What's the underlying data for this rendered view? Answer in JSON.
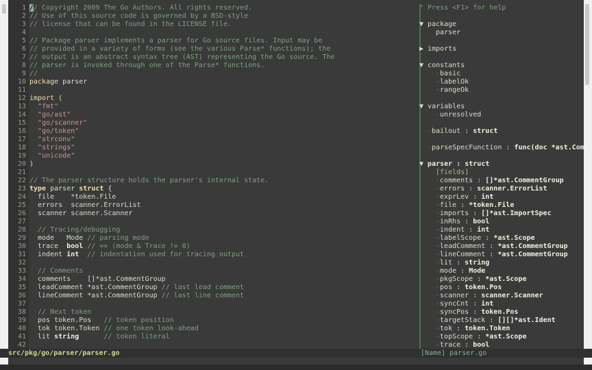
{
  "editor": {
    "cursor_line": 1,
    "lines": [
      [
        [
          "c",
          "// Copyright 2009 The Go Authors. All rights reserved."
        ]
      ],
      [
        [
          "c",
          "// Use of this source code is governed by a BSD-style"
        ]
      ],
      [
        [
          "c",
          "// license that can be found in the LICENSE file."
        ]
      ],
      [],
      [
        [
          "c",
          "// Package parser implements a parser for Go source files. Input may be"
        ]
      ],
      [
        [
          "c",
          "// provided in a variety of forms (see the various Parse* functions); the"
        ]
      ],
      [
        [
          "c",
          "// output is an abstract syntax tree (AST) representing the Go source. The"
        ]
      ],
      [
        [
          "c",
          "// parser is invoked through one of the Parse* functions."
        ]
      ],
      [
        [
          "c",
          "//"
        ]
      ],
      [
        [
          "kw",
          "package"
        ],
        [
          "t",
          " parser"
        ]
      ],
      [],
      [
        [
          "kw",
          "import"
        ],
        [
          "t",
          " ("
        ]
      ],
      [
        [
          "t",
          "  "
        ],
        [
          "s",
          "\"fmt\""
        ]
      ],
      [
        [
          "t",
          "  "
        ],
        [
          "s",
          "\"go/ast\""
        ]
      ],
      [
        [
          "t",
          "  "
        ],
        [
          "s",
          "\"go/scanner\""
        ]
      ],
      [
        [
          "t",
          "  "
        ],
        [
          "s",
          "\"go/token\""
        ]
      ],
      [
        [
          "t",
          "  "
        ],
        [
          "s",
          "\"strconv\""
        ]
      ],
      [
        [
          "t",
          "  "
        ],
        [
          "s",
          "\"strings\""
        ]
      ],
      [
        [
          "t",
          "  "
        ],
        [
          "s",
          "\"unicode\""
        ]
      ],
      [
        [
          "t",
          ")"
        ]
      ],
      [],
      [
        [
          "c",
          "// The parser structure holds the parser's internal state."
        ]
      ],
      [
        [
          "k",
          "type"
        ],
        [
          "t",
          " parser "
        ],
        [
          "k",
          "struct"
        ],
        [
          "t",
          " {"
        ]
      ],
      [
        [
          "t",
          "  file    *token.File"
        ]
      ],
      [
        [
          "t",
          "  errors  scanner.ErrorList"
        ]
      ],
      [
        [
          "t",
          "  scanner scanner.Scanner"
        ]
      ],
      [],
      [
        [
          "t",
          "  "
        ],
        [
          "c",
          "// Tracing/debugging"
        ]
      ],
      [
        [
          "t",
          "  mode   Mode "
        ],
        [
          "c",
          "// parsing mode"
        ]
      ],
      [
        [
          "t",
          "  trace  "
        ],
        [
          "b",
          "bool"
        ],
        [
          "t",
          " "
        ],
        [
          "c",
          "// == (mode & Trace != 0)"
        ]
      ],
      [
        [
          "t",
          "  indent "
        ],
        [
          "b",
          "int"
        ],
        [
          "t",
          "  "
        ],
        [
          "c",
          "// indentation used for tracing output"
        ]
      ],
      [],
      [
        [
          "t",
          "  "
        ],
        [
          "c",
          "// Comments"
        ]
      ],
      [
        [
          "t",
          "  comments    []*ast.CommentGroup"
        ]
      ],
      [
        [
          "t",
          "  leadComment *ast.CommentGroup "
        ],
        [
          "c",
          "// last lead comment"
        ]
      ],
      [
        [
          "t",
          "  lineComment *ast.CommentGroup "
        ],
        [
          "c",
          "// last line comment"
        ]
      ],
      [],
      [
        [
          "t",
          "  "
        ],
        [
          "c",
          "// Next token"
        ]
      ],
      [
        [
          "t",
          "  pos token.Pos   "
        ],
        [
          "c",
          "// token position"
        ]
      ],
      [
        [
          "t",
          "  tok token.Token "
        ],
        [
          "c",
          "// one token look-ahead"
        ]
      ],
      [
        [
          "t",
          "  lit "
        ],
        [
          "b",
          "string"
        ],
        [
          "t",
          "      "
        ],
        [
          "c",
          "// token literal"
        ]
      ],
      []
    ]
  },
  "tagbar": {
    "help": "\" Press <F1> for help",
    "items": [
      {
        "row": 0,
        "kind": "help"
      },
      {
        "row": 2,
        "kind": "group",
        "arrow": "▼",
        "name": "package"
      },
      {
        "row": 3,
        "kind": "plain",
        "indent": 2,
        "name": "parser"
      },
      {
        "row": 5,
        "kind": "group",
        "arrow": "▶",
        "name": "imports"
      },
      {
        "row": 7,
        "kind": "group",
        "arrow": "▼",
        "name": "constants"
      },
      {
        "row": 8,
        "kind": "leaf",
        "indent": 1,
        "name": "basic"
      },
      {
        "row": 9,
        "kind": "leaf",
        "indent": 1,
        "name": "labelOk"
      },
      {
        "row": 10,
        "kind": "leaf",
        "indent": 1,
        "name": "rangeOk"
      },
      {
        "row": 12,
        "kind": "group",
        "arrow": "▼",
        "name": "variables"
      },
      {
        "row": 13,
        "kind": "leaf",
        "indent": 1,
        "name": "unresolved"
      },
      {
        "row": 15,
        "kind": "leaf",
        "indent": 0,
        "name": "bailout",
        "type": "struct"
      },
      {
        "row": 17,
        "kind": "leaf",
        "indent": 0,
        "name": "parseSpecFunction",
        "type": "func(doc *ast.Comm"
      },
      {
        "row": 19,
        "kind": "struct",
        "arrow": "▼",
        "name": "parser",
        "type": "struct"
      },
      {
        "row": 20,
        "kind": "fields",
        "indent": 2,
        "name": "[fields]"
      },
      {
        "row": 21,
        "kind": "leaf",
        "indent": 1,
        "name": "comments",
        "type": "[]*ast.CommentGroup"
      },
      {
        "row": 22,
        "kind": "leaf",
        "indent": 1,
        "name": "errors",
        "type": "scanner.ErrorList"
      },
      {
        "row": 23,
        "kind": "leaf",
        "indent": 1,
        "name": "exprLev",
        "type": "int"
      },
      {
        "row": 24,
        "kind": "leaf",
        "indent": 1,
        "name": "file",
        "type": "*token.File"
      },
      {
        "row": 25,
        "kind": "leaf",
        "indent": 1,
        "name": "imports",
        "type": "[]*ast.ImportSpec"
      },
      {
        "row": 26,
        "kind": "leaf",
        "indent": 1,
        "name": "inRhs",
        "type": "bool"
      },
      {
        "row": 27,
        "kind": "leaf",
        "indent": 1,
        "name": "indent",
        "type": "int"
      },
      {
        "row": 28,
        "kind": "leaf",
        "indent": 1,
        "name": "labelScope",
        "type": "*ast.Scope"
      },
      {
        "row": 29,
        "kind": "leaf",
        "indent": 1,
        "name": "leadComment",
        "type": "*ast.CommentGroup"
      },
      {
        "row": 30,
        "kind": "leaf",
        "indent": 1,
        "name": "lineComment",
        "type": "*ast.CommentGroup"
      },
      {
        "row": 31,
        "kind": "leaf",
        "indent": 1,
        "name": "lit",
        "type": "string"
      },
      {
        "row": 32,
        "kind": "leaf",
        "indent": 1,
        "name": "mode",
        "type": "Mode"
      },
      {
        "row": 33,
        "kind": "leaf",
        "indent": 1,
        "name": "pkgScope",
        "type": "*ast.Scope"
      },
      {
        "row": 34,
        "kind": "leaf",
        "indent": 1,
        "name": "pos",
        "type": "token.Pos"
      },
      {
        "row": 35,
        "kind": "leaf",
        "indent": 1,
        "name": "scanner",
        "type": "scanner.Scanner"
      },
      {
        "row": 36,
        "kind": "leaf",
        "indent": 1,
        "name": "syncCnt",
        "type": "int"
      },
      {
        "row": 37,
        "kind": "leaf",
        "indent": 1,
        "name": "syncPos",
        "type": "token.Pos"
      },
      {
        "row": 38,
        "kind": "leaf",
        "indent": 1,
        "name": "targetStack",
        "type": "[][]*ast.Ident"
      },
      {
        "row": 39,
        "kind": "leaf",
        "indent": 1,
        "name": "tok",
        "type": "token.Token"
      },
      {
        "row": 40,
        "kind": "leaf",
        "indent": 1,
        "name": "topScope",
        "type": "*ast.Scope"
      },
      {
        "row": 41,
        "kind": "leaf",
        "indent": 1,
        "name": "trace",
        "type": "bool"
      }
    ]
  },
  "status": {
    "file_path": "src/pkg/go/parser/parser.go",
    "tagbar_label": "[Name] parser.go"
  },
  "colors": {
    "comment": "#7f9f7f",
    "keyword": "#f0dfaf",
    "string": "#cc9393",
    "text": "#dcdccc",
    "tree_dash": "#e04040"
  }
}
